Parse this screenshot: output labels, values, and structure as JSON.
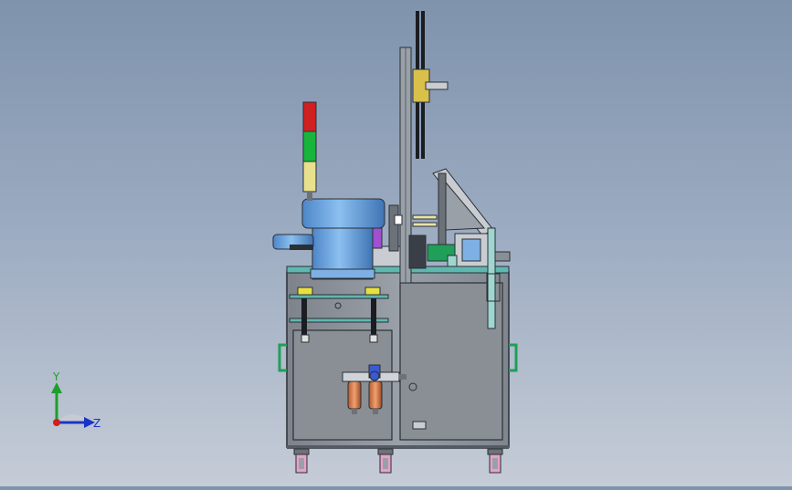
{
  "triad": {
    "y_label": "Y",
    "z_label": "Z",
    "y_color": "#1e9e2a",
    "z_color": "#1a34c8",
    "x_color": "#d01f1f"
  },
  "colors": {
    "background_top": "#7f93ad",
    "background_bottom": "#c5ccd7",
    "frame": "#8f949b",
    "frame_edge": "#2b2f36",
    "bowl": "#6ea6e0",
    "light_red": "#d02020",
    "light_green": "#19b43c",
    "light_yellow": "#e8e08c",
    "glass": "#9fd6d0",
    "filter": "#e08a5a"
  },
  "icons": {
    "triad": "view-orientation-triad-icon"
  }
}
